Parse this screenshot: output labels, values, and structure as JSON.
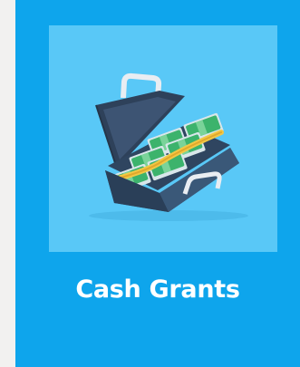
{
  "card": {
    "title": "Cash Grants",
    "icon": "briefcase-of-money-icon",
    "colors": {
      "card_background": "#0ea5ec",
      "tile_background": "#59c8f7",
      "page_background": "#f2f1f0",
      "title_text": "#ffffff"
    }
  }
}
